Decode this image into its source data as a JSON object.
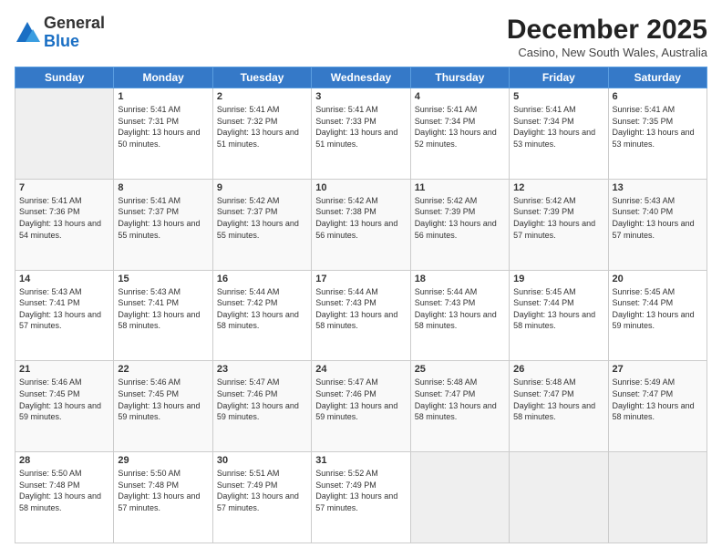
{
  "header": {
    "logo_general": "General",
    "logo_blue": "Blue",
    "month_title": "December 2025",
    "subtitle": "Casino, New South Wales, Australia"
  },
  "calendar": {
    "days_of_week": [
      "Sunday",
      "Monday",
      "Tuesday",
      "Wednesday",
      "Thursday",
      "Friday",
      "Saturday"
    ],
    "weeks": [
      [
        {
          "day": "",
          "empty": true
        },
        {
          "day": "1",
          "sunrise": "Sunrise: 5:41 AM",
          "sunset": "Sunset: 7:31 PM",
          "daylight": "Daylight: 13 hours and 50 minutes."
        },
        {
          "day": "2",
          "sunrise": "Sunrise: 5:41 AM",
          "sunset": "Sunset: 7:32 PM",
          "daylight": "Daylight: 13 hours and 51 minutes."
        },
        {
          "day": "3",
          "sunrise": "Sunrise: 5:41 AM",
          "sunset": "Sunset: 7:33 PM",
          "daylight": "Daylight: 13 hours and 51 minutes."
        },
        {
          "day": "4",
          "sunrise": "Sunrise: 5:41 AM",
          "sunset": "Sunset: 7:34 PM",
          "daylight": "Daylight: 13 hours and 52 minutes."
        },
        {
          "day": "5",
          "sunrise": "Sunrise: 5:41 AM",
          "sunset": "Sunset: 7:34 PM",
          "daylight": "Daylight: 13 hours and 53 minutes."
        },
        {
          "day": "6",
          "sunrise": "Sunrise: 5:41 AM",
          "sunset": "Sunset: 7:35 PM",
          "daylight": "Daylight: 13 hours and 53 minutes."
        }
      ],
      [
        {
          "day": "7",
          "sunrise": "Sunrise: 5:41 AM",
          "sunset": "Sunset: 7:36 PM",
          "daylight": "Daylight: 13 hours and 54 minutes."
        },
        {
          "day": "8",
          "sunrise": "Sunrise: 5:41 AM",
          "sunset": "Sunset: 7:37 PM",
          "daylight": "Daylight: 13 hours and 55 minutes."
        },
        {
          "day": "9",
          "sunrise": "Sunrise: 5:42 AM",
          "sunset": "Sunset: 7:37 PM",
          "daylight": "Daylight: 13 hours and 55 minutes."
        },
        {
          "day": "10",
          "sunrise": "Sunrise: 5:42 AM",
          "sunset": "Sunset: 7:38 PM",
          "daylight": "Daylight: 13 hours and 56 minutes."
        },
        {
          "day": "11",
          "sunrise": "Sunrise: 5:42 AM",
          "sunset": "Sunset: 7:39 PM",
          "daylight": "Daylight: 13 hours and 56 minutes."
        },
        {
          "day": "12",
          "sunrise": "Sunrise: 5:42 AM",
          "sunset": "Sunset: 7:39 PM",
          "daylight": "Daylight: 13 hours and 57 minutes."
        },
        {
          "day": "13",
          "sunrise": "Sunrise: 5:43 AM",
          "sunset": "Sunset: 7:40 PM",
          "daylight": "Daylight: 13 hours and 57 minutes."
        }
      ],
      [
        {
          "day": "14",
          "sunrise": "Sunrise: 5:43 AM",
          "sunset": "Sunset: 7:41 PM",
          "daylight": "Daylight: 13 hours and 57 minutes."
        },
        {
          "day": "15",
          "sunrise": "Sunrise: 5:43 AM",
          "sunset": "Sunset: 7:41 PM",
          "daylight": "Daylight: 13 hours and 58 minutes."
        },
        {
          "day": "16",
          "sunrise": "Sunrise: 5:44 AM",
          "sunset": "Sunset: 7:42 PM",
          "daylight": "Daylight: 13 hours and 58 minutes."
        },
        {
          "day": "17",
          "sunrise": "Sunrise: 5:44 AM",
          "sunset": "Sunset: 7:43 PM",
          "daylight": "Daylight: 13 hours and 58 minutes."
        },
        {
          "day": "18",
          "sunrise": "Sunrise: 5:44 AM",
          "sunset": "Sunset: 7:43 PM",
          "daylight": "Daylight: 13 hours and 58 minutes."
        },
        {
          "day": "19",
          "sunrise": "Sunrise: 5:45 AM",
          "sunset": "Sunset: 7:44 PM",
          "daylight": "Daylight: 13 hours and 58 minutes."
        },
        {
          "day": "20",
          "sunrise": "Sunrise: 5:45 AM",
          "sunset": "Sunset: 7:44 PM",
          "daylight": "Daylight: 13 hours and 59 minutes."
        }
      ],
      [
        {
          "day": "21",
          "sunrise": "Sunrise: 5:46 AM",
          "sunset": "Sunset: 7:45 PM",
          "daylight": "Daylight: 13 hours and 59 minutes."
        },
        {
          "day": "22",
          "sunrise": "Sunrise: 5:46 AM",
          "sunset": "Sunset: 7:45 PM",
          "daylight": "Daylight: 13 hours and 59 minutes."
        },
        {
          "day": "23",
          "sunrise": "Sunrise: 5:47 AM",
          "sunset": "Sunset: 7:46 PM",
          "daylight": "Daylight: 13 hours and 59 minutes."
        },
        {
          "day": "24",
          "sunrise": "Sunrise: 5:47 AM",
          "sunset": "Sunset: 7:46 PM",
          "daylight": "Daylight: 13 hours and 59 minutes."
        },
        {
          "day": "25",
          "sunrise": "Sunrise: 5:48 AM",
          "sunset": "Sunset: 7:47 PM",
          "daylight": "Daylight: 13 hours and 58 minutes."
        },
        {
          "day": "26",
          "sunrise": "Sunrise: 5:48 AM",
          "sunset": "Sunset: 7:47 PM",
          "daylight": "Daylight: 13 hours and 58 minutes."
        },
        {
          "day": "27",
          "sunrise": "Sunrise: 5:49 AM",
          "sunset": "Sunset: 7:47 PM",
          "daylight": "Daylight: 13 hours and 58 minutes."
        }
      ],
      [
        {
          "day": "28",
          "sunrise": "Sunrise: 5:50 AM",
          "sunset": "Sunset: 7:48 PM",
          "daylight": "Daylight: 13 hours and 58 minutes."
        },
        {
          "day": "29",
          "sunrise": "Sunrise: 5:50 AM",
          "sunset": "Sunset: 7:48 PM",
          "daylight": "Daylight: 13 hours and 57 minutes."
        },
        {
          "day": "30",
          "sunrise": "Sunrise: 5:51 AM",
          "sunset": "Sunset: 7:49 PM",
          "daylight": "Daylight: 13 hours and 57 minutes."
        },
        {
          "day": "31",
          "sunrise": "Sunrise: 5:52 AM",
          "sunset": "Sunset: 7:49 PM",
          "daylight": "Daylight: 13 hours and 57 minutes."
        },
        {
          "day": "",
          "empty": true
        },
        {
          "day": "",
          "empty": true
        },
        {
          "day": "",
          "empty": true
        }
      ]
    ]
  }
}
